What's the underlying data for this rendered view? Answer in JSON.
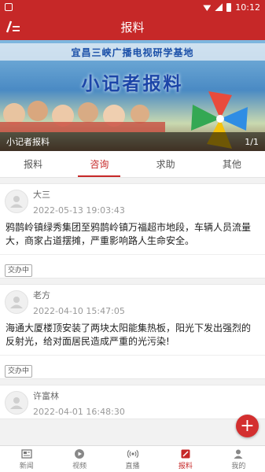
{
  "statusbar": {
    "time": "10:12"
  },
  "header": {
    "title": "报料"
  },
  "banner": {
    "band_text": "宜昌三峡广播电视研学基地",
    "slogan": "小记者报料",
    "caption": "小记者报料",
    "counter": "1/1"
  },
  "tabs": [
    {
      "label": "报料"
    },
    {
      "label": "咨询"
    },
    {
      "label": "求助"
    },
    {
      "label": "其他"
    }
  ],
  "posts": [
    {
      "name": "大三",
      "time": "2022-05-13 19:03:43",
      "content": "鸦鹊岭镇绿秀集团至鸦鹊岭镇万福超市地段，车辆人员流量大，商家占道摆摊，严重影响路人生命安全。",
      "status": "交办中"
    },
    {
      "name": "老方",
      "time": "2022-04-10 15:47:05",
      "content": "海通大厦楼顶安装了两块太阳能集热板，阳光下发出强烈的反射光，给对面居民造成严重的光污染!",
      "status": "交办中"
    },
    {
      "name": "许富林",
      "time": "2022-04-01 16:48:30",
      "content": "",
      "status": ""
    }
  ],
  "fab": {
    "label": "+"
  },
  "bottomnav": [
    {
      "label": "新闻",
      "icon": "news-icon"
    },
    {
      "label": "视频",
      "icon": "video-icon"
    },
    {
      "label": "直播",
      "icon": "live-icon"
    },
    {
      "label": "报料",
      "icon": "report-icon"
    },
    {
      "label": "我的",
      "icon": "profile-icon"
    }
  ],
  "colors": {
    "brand": "#c62828",
    "fab": "#d32f2f"
  }
}
